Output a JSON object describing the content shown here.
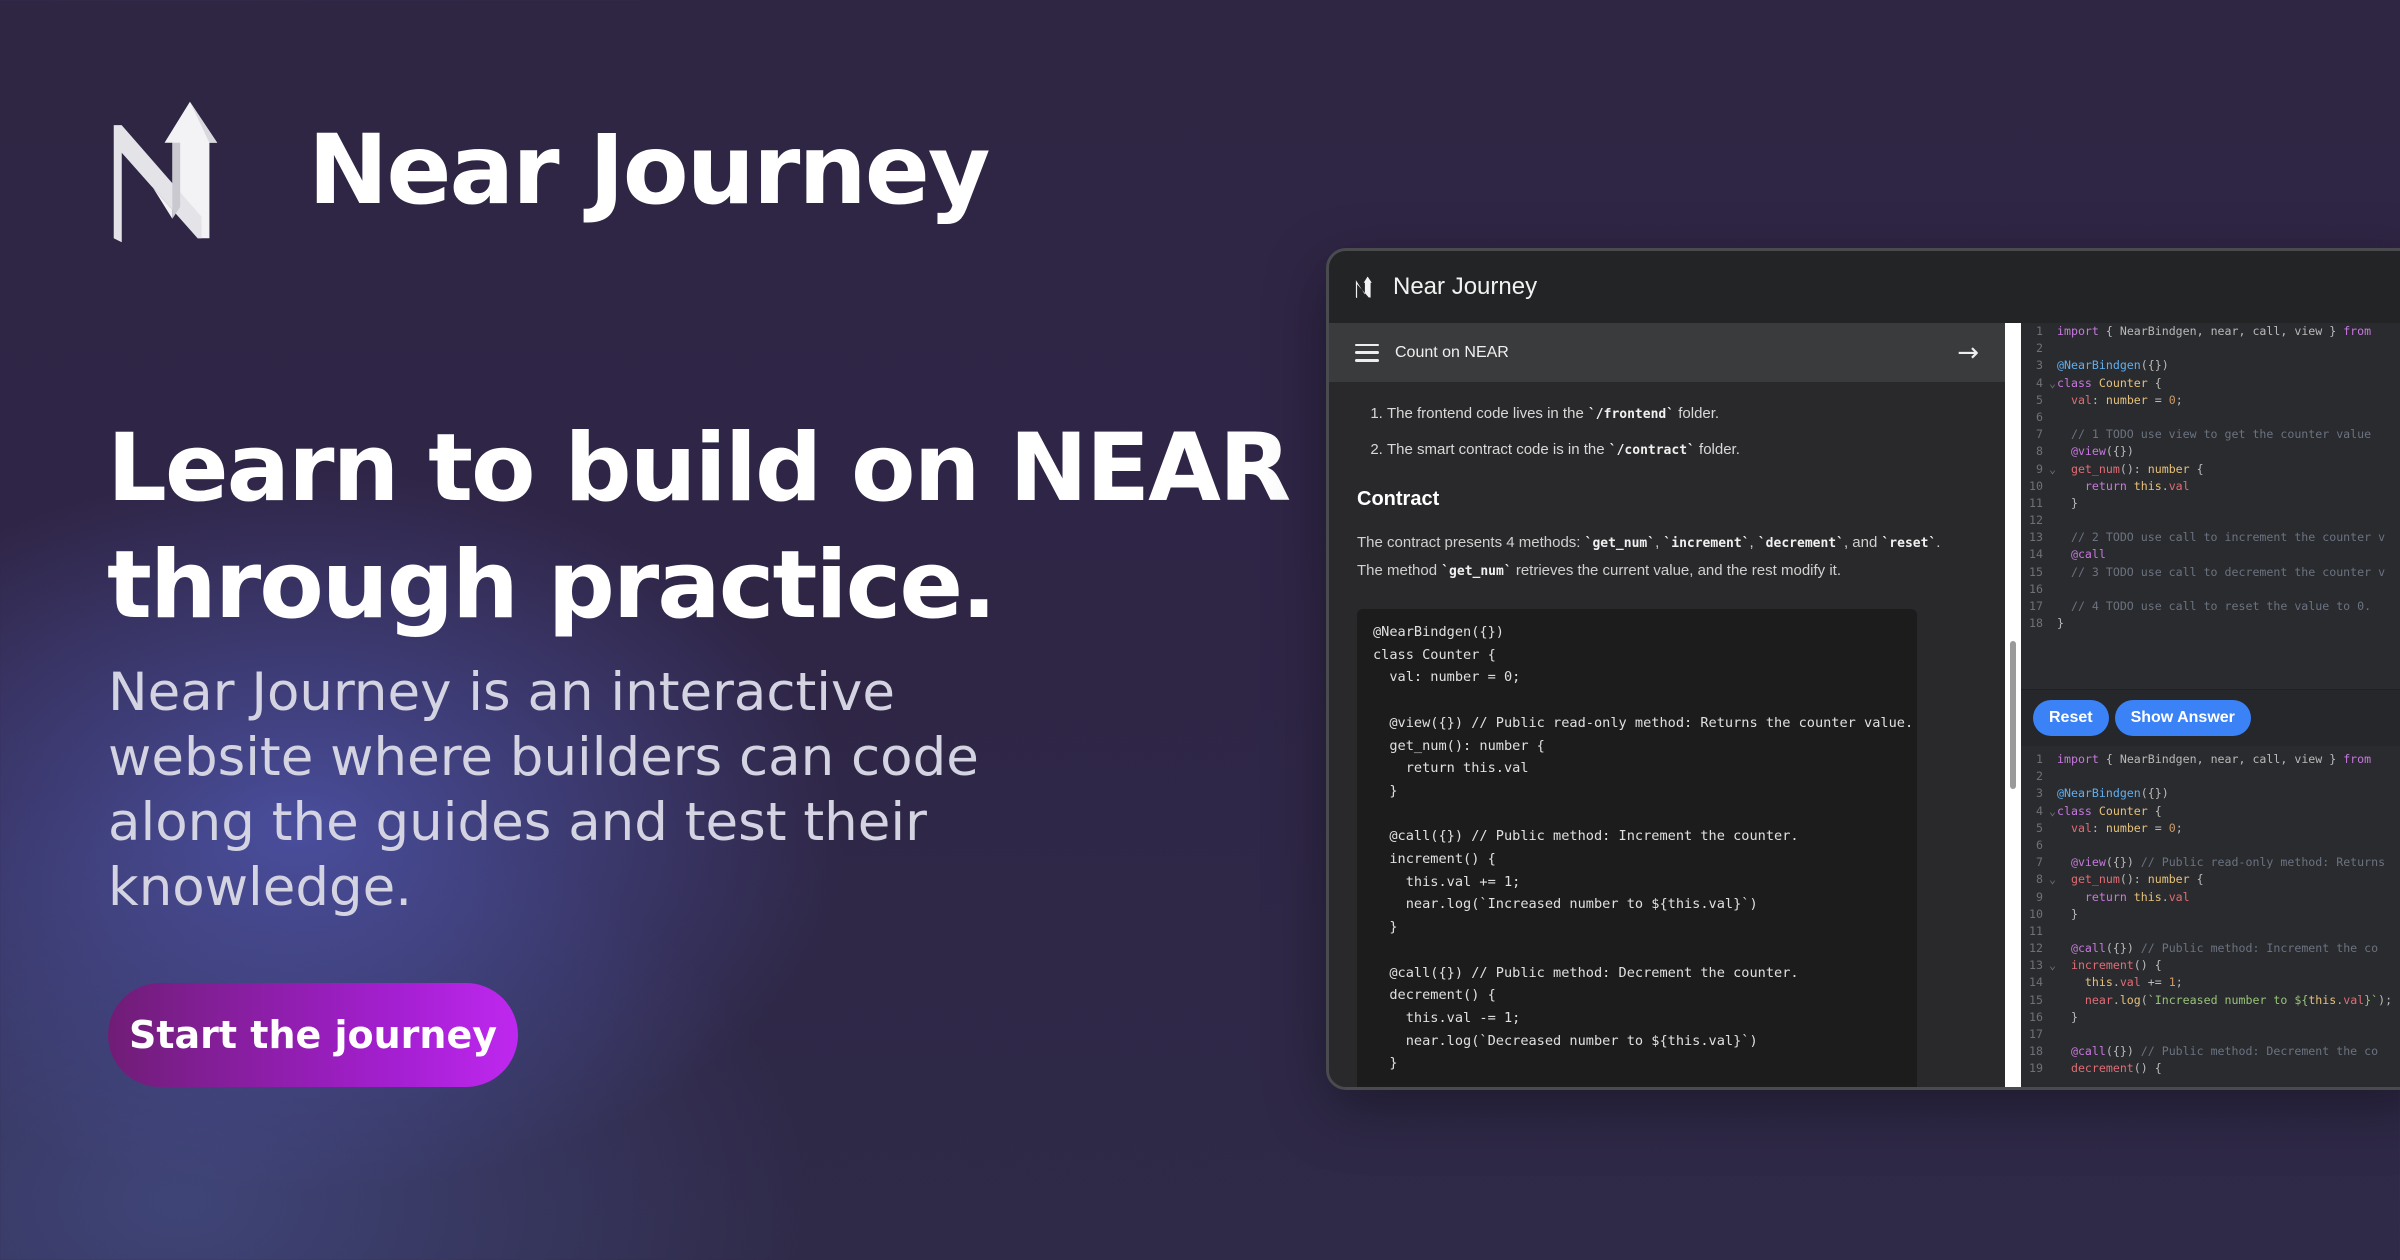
{
  "brand": {
    "name": "Near Journey"
  },
  "hero": {
    "headline": "Learn to build on NEAR through practice.",
    "subtitle": "Near Journey is an interactive website where builders can code along the guides and test their knowledge.",
    "cta": "Start the journey"
  },
  "app": {
    "title": "Near Journey",
    "lesson": {
      "title": "Count on NEAR",
      "steps": [
        {
          "pre": "The frontend code lives in the ",
          "code": "`/frontend`",
          "post": " folder."
        },
        {
          "pre": "The smart contract code is in the ",
          "code": "`/contract`",
          "post": " folder."
        }
      ],
      "contract_heading": "Contract",
      "contract_text": {
        "p1": "The contract presents 4 methods: ",
        "m1": "`get_num`",
        "s1": ", ",
        "m2": "`increment`",
        "s2": ", ",
        "m3": "`decrement`",
        "s3": ", and ",
        "m4": "`reset`",
        "p2": ". The method ",
        "m5": "`get_num`",
        "p3": " retrieves the current value, and the rest modify it."
      },
      "code": "@NearBindgen({})\nclass Counter {\n  val: number = 0;\n\n  @view({}) // Public read-only method: Returns the counter value.\n  get_num(): number {\n    return this.val\n  }\n\n  @call({}) // Public method: Increment the counter.\n  increment() {\n    this.val += 1;\n    near.log(`Increased number to ${this.val}`)\n  }\n\n  @call({}) // Public method: Decrement the counter.\n  decrement() {\n    this.val -= 1;\n    near.log(`Decreased number to ${this.val}`)\n  }"
    },
    "buttons": {
      "reset": "Reset",
      "show_answer": "Show Answer"
    }
  },
  "editor_top": [
    {
      "n": "1",
      "f": "",
      "t": [
        [
          "kw",
          "import "
        ],
        [
          "src",
          "{ NearBindgen, near, call, view } "
        ],
        [
          "kw",
          "from"
        ]
      ]
    },
    {
      "n": "2",
      "f": "",
      "t": []
    },
    {
      "n": "3",
      "f": "",
      "t": [
        [
          "dec",
          "@NearBindgen"
        ],
        [
          "src",
          "({})"
        ]
      ]
    },
    {
      "n": "4",
      "f": "⌄",
      "t": [
        [
          "kw",
          "class "
        ],
        [
          "ty",
          "Counter "
        ],
        [
          "src",
          "{"
        ]
      ]
    },
    {
      "n": "5",
      "f": "",
      "t": [
        [
          "src",
          "  "
        ],
        [
          "prop",
          "val"
        ],
        [
          "src",
          ": "
        ],
        [
          "ty",
          "number"
        ],
        [
          "src",
          " = "
        ],
        [
          "nm",
          "0"
        ],
        [
          "src",
          ";"
        ]
      ]
    },
    {
      "n": "6",
      "f": "",
      "t": []
    },
    {
      "n": "7",
      "f": "",
      "t": [
        [
          "cm",
          "  // 1 TODO use view to get the counter value"
        ]
      ]
    },
    {
      "n": "8",
      "f": "",
      "t": [
        [
          "src",
          "  "
        ],
        [
          "kw",
          "@view"
        ],
        [
          "src",
          "({})"
        ]
      ]
    },
    {
      "n": "9",
      "f": "⌄",
      "t": [
        [
          "src",
          "  "
        ],
        [
          "prop",
          "get_num"
        ],
        [
          "src",
          "(): "
        ],
        [
          "ty",
          "number"
        ],
        [
          "src",
          " {"
        ]
      ]
    },
    {
      "n": "10",
      "f": "",
      "t": [
        [
          "src",
          "    "
        ],
        [
          "kw",
          "return "
        ],
        [
          "ty",
          "this"
        ],
        [
          "src",
          "."
        ],
        [
          "prop",
          "val"
        ]
      ]
    },
    {
      "n": "11",
      "f": "",
      "t": [
        [
          "src",
          "  }"
        ]
      ]
    },
    {
      "n": "12",
      "f": "",
      "t": []
    },
    {
      "n": "13",
      "f": "",
      "t": [
        [
          "cm",
          "  // 2 TODO use call to increment the counter v"
        ]
      ]
    },
    {
      "n": "14",
      "f": "",
      "t": [
        [
          "src",
          "  "
        ],
        [
          "kw",
          "@call"
        ]
      ]
    },
    {
      "n": "15",
      "f": "",
      "t": [
        [
          "cm",
          "  // 3 TODO use call to decrement the counter v"
        ]
      ]
    },
    {
      "n": "16",
      "f": "",
      "t": []
    },
    {
      "n": "17",
      "f": "",
      "t": [
        [
          "cm",
          "  // 4 TODO use call to reset the value to 0."
        ]
      ]
    },
    {
      "n": "18",
      "f": "",
      "t": [
        [
          "src",
          "}"
        ]
      ]
    }
  ],
  "editor_bottom": [
    {
      "n": "1",
      "f": "",
      "t": [
        [
          "kw",
          "import "
        ],
        [
          "src",
          "{ NearBindgen, near, call, view } "
        ],
        [
          "kw",
          "from"
        ]
      ]
    },
    {
      "n": "2",
      "f": "",
      "t": []
    },
    {
      "n": "3",
      "f": "",
      "t": [
        [
          "dec",
          "@NearBindgen"
        ],
        [
          "src",
          "({})"
        ]
      ]
    },
    {
      "n": "4",
      "f": "⌄",
      "t": [
        [
          "kw",
          "class "
        ],
        [
          "ty",
          "Counter "
        ],
        [
          "src",
          "{"
        ]
      ]
    },
    {
      "n": "5",
      "f": "",
      "t": [
        [
          "src",
          "  "
        ],
        [
          "prop",
          "val"
        ],
        [
          "src",
          ": "
        ],
        [
          "ty",
          "number"
        ],
        [
          "src",
          " = "
        ],
        [
          "nm",
          "0"
        ],
        [
          "src",
          ";"
        ]
      ]
    },
    {
      "n": "6",
      "f": "",
      "t": []
    },
    {
      "n": "7",
      "f": "",
      "t": [
        [
          "src",
          "  "
        ],
        [
          "kw",
          "@view"
        ],
        [
          "src",
          "({}) "
        ],
        [
          "cm",
          "// Public read-only method: Returns"
        ]
      ]
    },
    {
      "n": "8",
      "f": "⌄",
      "t": [
        [
          "src",
          "  "
        ],
        [
          "prop",
          "get_num"
        ],
        [
          "src",
          "(): "
        ],
        [
          "ty",
          "number"
        ],
        [
          "src",
          " {"
        ]
      ]
    },
    {
      "n": "9",
      "f": "",
      "t": [
        [
          "src",
          "    "
        ],
        [
          "kw",
          "return "
        ],
        [
          "ty",
          "this"
        ],
        [
          "src",
          "."
        ],
        [
          "prop",
          "val"
        ]
      ]
    },
    {
      "n": "10",
      "f": "",
      "t": [
        [
          "src",
          "  }"
        ]
      ]
    },
    {
      "n": "11",
      "f": "",
      "t": []
    },
    {
      "n": "12",
      "f": "",
      "t": [
        [
          "src",
          "  "
        ],
        [
          "kw",
          "@call"
        ],
        [
          "src",
          "({}) "
        ],
        [
          "cm",
          "// Public method: Increment the co"
        ]
      ]
    },
    {
      "n": "13",
      "f": "⌄",
      "t": [
        [
          "src",
          "  "
        ],
        [
          "prop",
          "increment"
        ],
        [
          "src",
          "() {"
        ]
      ]
    },
    {
      "n": "14",
      "f": "",
      "t": [
        [
          "src",
          "    "
        ],
        [
          "ty",
          "this"
        ],
        [
          "src",
          "."
        ],
        [
          "prop",
          "val"
        ],
        [
          "src",
          " += "
        ],
        [
          "nm",
          "1"
        ],
        [
          "src",
          ";"
        ]
      ]
    },
    {
      "n": "15",
      "f": "",
      "t": [
        [
          "src",
          "    "
        ],
        [
          "prop",
          "near"
        ],
        [
          "src",
          "."
        ],
        [
          "fn",
          "log"
        ],
        [
          "src",
          "("
        ],
        [
          "str",
          "`Increased number to ${"
        ],
        [
          "ty",
          "this"
        ],
        [
          "str",
          "."
        ],
        [
          "prop",
          "val"
        ],
        [
          "str",
          "}`"
        ],
        [
          "src",
          ");"
        ]
      ]
    },
    {
      "n": "16",
      "f": "",
      "t": [
        [
          "src",
          "  }"
        ]
      ]
    },
    {
      "n": "17",
      "f": "",
      "t": []
    },
    {
      "n": "18",
      "f": "",
      "t": [
        [
          "src",
          "  "
        ],
        [
          "kw",
          "@call"
        ],
        [
          "src",
          "({}) "
        ],
        [
          "cm",
          "// Public method: Decrement the co"
        ]
      ]
    },
    {
      "n": "19",
      "f": "",
      "t": [
        [
          "src",
          "  "
        ],
        [
          "prop",
          "decrement"
        ],
        [
          "src",
          "() {"
        ]
      ]
    }
  ]
}
